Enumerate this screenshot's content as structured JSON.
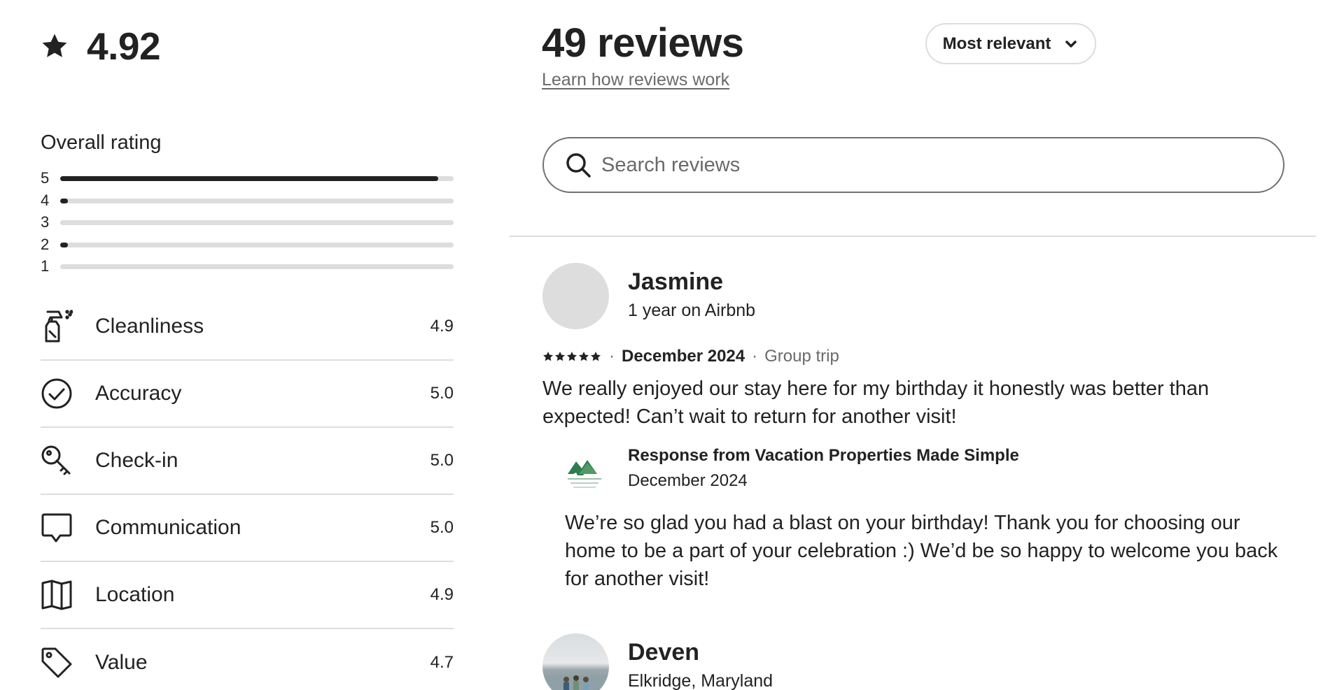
{
  "summary": {
    "average_rating": "4.92",
    "overall_title": "Overall rating",
    "distribution": [
      {
        "stars": "5",
        "fraction": 0.96
      },
      {
        "stars": "4",
        "fraction": 0.02
      },
      {
        "stars": "3",
        "fraction": 0.0
      },
      {
        "stars": "2",
        "fraction": 0.02
      },
      {
        "stars": "1",
        "fraction": 0.0
      }
    ],
    "categories": [
      {
        "label": "Cleanliness",
        "score": "4.9",
        "icon": "spray-bottle-icon"
      },
      {
        "label": "Accuracy",
        "score": "5.0",
        "icon": "check-circle-icon"
      },
      {
        "label": "Check-in",
        "score": "5.0",
        "icon": "key-icon"
      },
      {
        "label": "Communication",
        "score": "5.0",
        "icon": "chat-bubble-icon"
      },
      {
        "label": "Location",
        "score": "4.9",
        "icon": "map-icon"
      },
      {
        "label": "Value",
        "score": "4.7",
        "icon": "price-tag-icon"
      }
    ]
  },
  "header": {
    "reviews_count_label": "49 reviews",
    "learn_link": "Learn how reviews work",
    "sort_label": "Most relevant"
  },
  "search": {
    "placeholder": "Search reviews",
    "value": ""
  },
  "reviews": [
    {
      "name": "Jasmine",
      "meta": "1 year on Airbnb",
      "stars": 5,
      "date": "December 2024",
      "trip_type": "Group trip",
      "text": "We really enjoyed our stay here for my birthday it honestly was better than expected! Can’t wait to return for another visit!",
      "response": {
        "title": "Response from Vacation Properties Made Simple",
        "date": "December 2024",
        "text": "We’re so glad you had a blast on your birthday! Thank you for choosing our home to be a part of your celebration :) We’d be so happy to welcome you back for another visit!"
      }
    },
    {
      "name": "Deven",
      "meta": "Elkridge, Maryland"
    }
  ],
  "colors": {
    "text": "#222222",
    "muted": "#6a6a6a",
    "divider": "#dddddd",
    "logo_green": "#2e7d4f"
  }
}
